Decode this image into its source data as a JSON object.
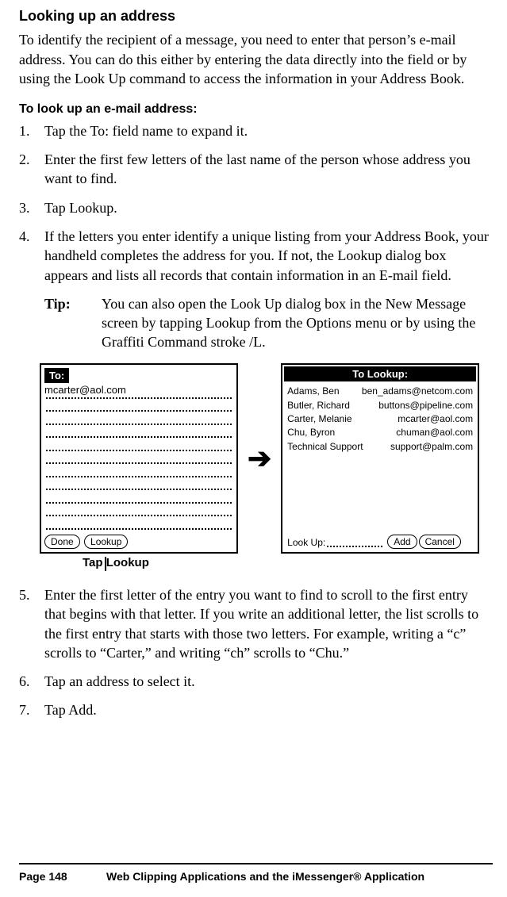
{
  "headings": {
    "main": "Looking up an address",
    "sub": "To look up an e-mail address:"
  },
  "intro": "To identify the recipient of a message, you need to enter that person’s e-mail address. You can do this either by entering the data directly into the field or by using the Look Up command to access the information in your Address Book.",
  "steps": {
    "s1": "Tap the To: field name to expand it.",
    "s2": "Enter the first few letters of the last name of the person whose address you want to find.",
    "s3": "Tap Lookup.",
    "s4": "If the letters you enter identify a unique listing from your Address Book, your handheld completes the address for you. If not, the Lookup dialog box appears and lists all records that contain information in an E-mail field.",
    "s5": "Enter the first letter of the entry you want to find to scroll to the first entry that begins with that letter. If you write an additional letter, the list scrolls to the first entry that starts with those two letters. For example, writing a “c” scrolls to “Carter,” and writing “ch” scrolls to “Chu.”",
    "s6": "Tap an address to select it.",
    "s7": "Tap Add."
  },
  "tip": {
    "label": "Tip:",
    "body": "You can also open the Look Up dialog box in the New Message screen by tapping Lookup from the Options menu or by using the Graffiti Command stroke /L."
  },
  "palmLeft": {
    "title": "To:",
    "value": "mcarter@aol.com",
    "buttons": {
      "done": "Done",
      "lookup": "Lookup"
    }
  },
  "palmRight": {
    "title": "To Lookup:",
    "rows": [
      {
        "name": "Adams, Ben",
        "email": "ben_adams@netcom.com"
      },
      {
        "name": "Butler, Richard",
        "email": "buttons@pipeline.com"
      },
      {
        "name": "Carter, Melanie",
        "email": "mcarter@aol.com"
      },
      {
        "name": "Chu, Byron",
        "email": "chuman@aol.com"
      },
      {
        "name": "Technical Support",
        "email": "support@palm.com"
      }
    ],
    "footerLabel": "Look Up:",
    "buttons": {
      "add": "Add",
      "cancel": "Cancel"
    }
  },
  "callout": "Tap Lookup",
  "footer": {
    "page": "Page 148",
    "chapter": "Web Clipping Applications and the iMessenger® Application"
  }
}
